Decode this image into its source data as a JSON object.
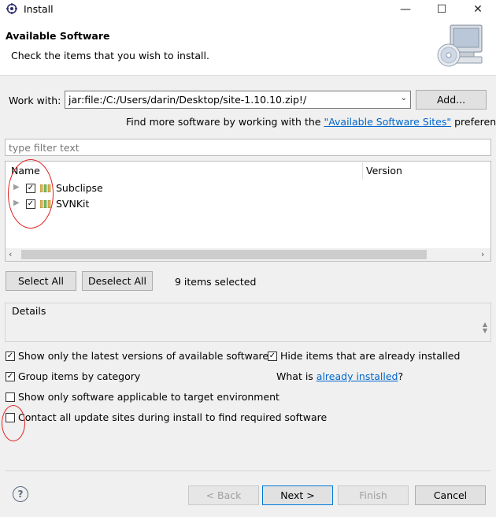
{
  "window": {
    "title": "Install",
    "controls": [
      "—",
      "☐",
      "✕"
    ]
  },
  "header": {
    "title": "Available Software",
    "subtitle": "Check the items that you wish to install."
  },
  "work_with": {
    "label": "Work with:",
    "value": "jar:file:/C:/Users/darin/Desktop/site-1.10.10.zip!/",
    "add_label": "Add...",
    "find_more_prefix": "Find more software by working with the",
    "find_more_link": "\"Available Software Sites\"",
    "find_more_suffix": "preferences."
  },
  "filter": {
    "placeholder": "type filter text"
  },
  "tree": {
    "columns": [
      "Name",
      "Version"
    ],
    "items": [
      {
        "label": "Subclipse",
        "checked": true
      },
      {
        "label": "SVNKit",
        "checked": true
      }
    ]
  },
  "selection": {
    "select_all": "Select All",
    "deselect_all": "Deselect All",
    "count_text": "9 items selected"
  },
  "details": {
    "label": "Details"
  },
  "options": {
    "latest_versions": "Show only the latest versions of available software",
    "hide_installed": "Hide items that are already installed",
    "group_by_category": "Group items by category",
    "what_is_prefix": "What is",
    "what_is_link": "already installed",
    "what_is_suffix": "?",
    "target_env": "Show only software applicable to target environment",
    "contact_sites": "Contact all update sites during install to find required software"
  },
  "footer": {
    "help_icon": "?",
    "back": "< Back",
    "next": "Next >",
    "finish": "Finish",
    "cancel": "Cancel"
  },
  "icons": {
    "app": "eclipse-install-icon",
    "header_art": "computer-cd-icon",
    "feature": "feature-group-icon"
  },
  "colors": {
    "link": "#0066cc",
    "annotation": "#e02020"
  }
}
